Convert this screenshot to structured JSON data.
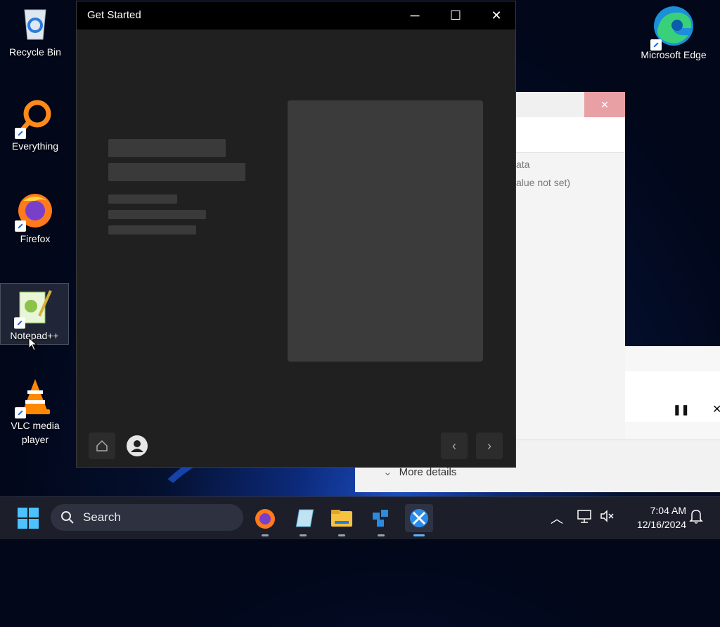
{
  "desktop": {
    "icons": [
      {
        "label": "Recycle Bin",
        "icon": "recycle-bin-icon"
      },
      {
        "label": "Everything",
        "icon": "everything-search-icon"
      },
      {
        "label": "Firefox",
        "icon": "firefox-icon"
      },
      {
        "label": "Notepad++",
        "icon": "notepad-plus-plus-icon"
      },
      {
        "label": "VLC media player",
        "icon": "vlc-icon"
      },
      {
        "label": "Microsoft Edge",
        "icon": "edge-icon"
      }
    ]
  },
  "background_windows": {
    "registry_text_1": "ata",
    "registry_text_2": "alue not set)",
    "more_details": "More details"
  },
  "window": {
    "title": "Get Started",
    "minimize": "─",
    "maximize": "☐",
    "close": "✕"
  },
  "taskbar": {
    "search_label": "Search",
    "time": "7:04 AM",
    "date": "12/16/2024",
    "apps": [
      "firefox-icon",
      "notepad-icon",
      "file-explorer-icon",
      "deploy-icon",
      "get-started-icon"
    ]
  },
  "colors": {
    "accent": "#5fb2ff",
    "window_bg": "#202020",
    "titlebar_bg": "#000000"
  }
}
